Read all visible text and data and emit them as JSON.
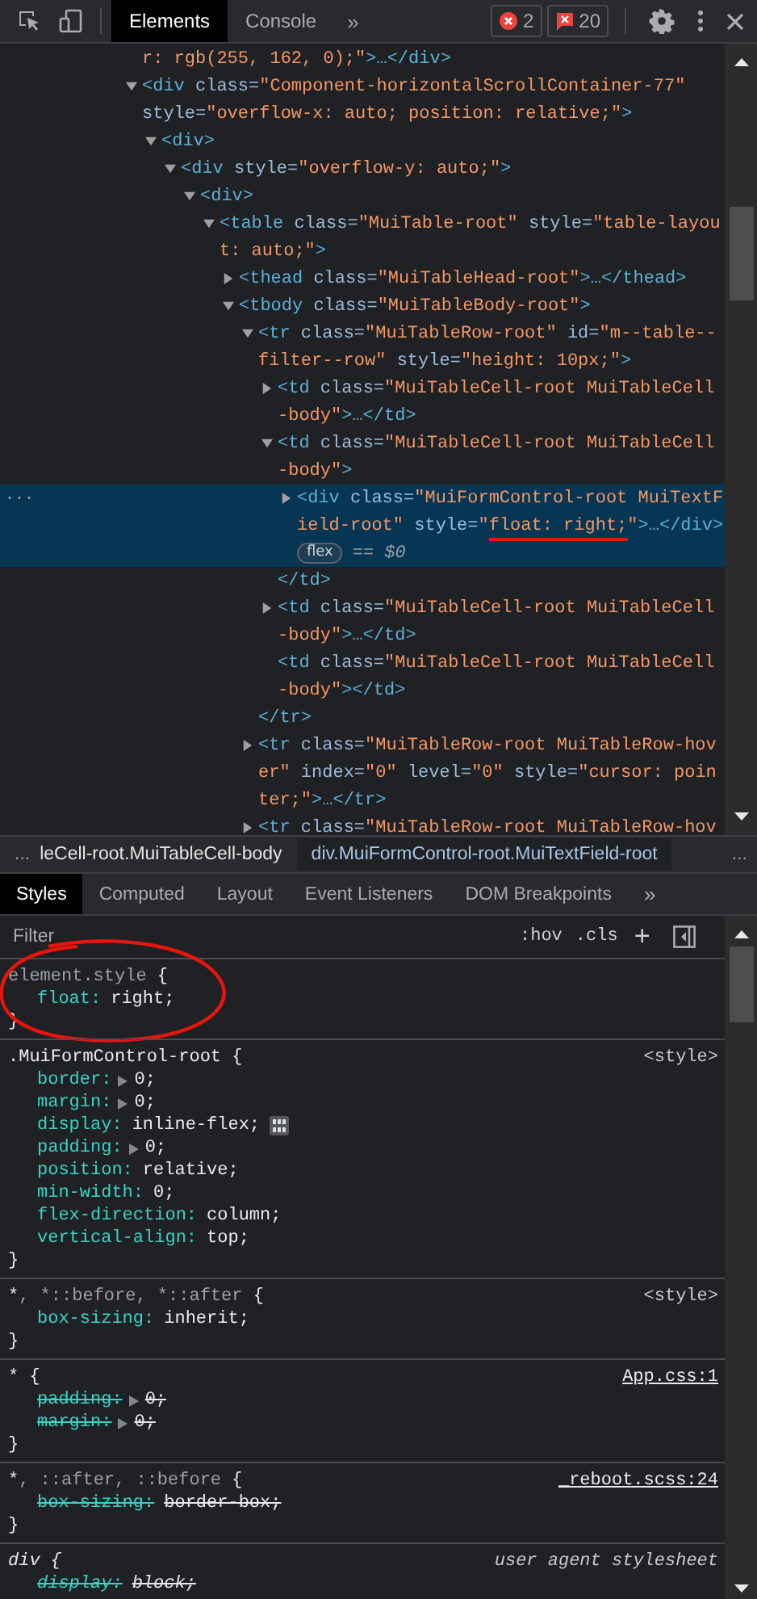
{
  "toolbar": {
    "tabs": [
      {
        "label": "Elements",
        "selected": true
      },
      {
        "label": "Console",
        "selected": false
      }
    ],
    "more": "»",
    "errors": "2",
    "warnings": "20"
  },
  "dom": [
    {
      "selected": false,
      "lines": [
        [
          {
            "kind": "val",
            "text": "r: rgb(255, 162, 0);\""
          },
          {
            "kind": "tag",
            "text": ">…</div>"
          }
        ]
      ]
    },
    {
      "selected": false,
      "expanded": true,
      "lines": [
        [
          {
            "kind": "tag",
            "text": "<div"
          },
          {
            "kind": "attr",
            "text": " class="
          },
          {
            "kind": "val",
            "text": "\"Component-horizontalScrollContainer-77\""
          }
        ],
        [
          {
            "kind": "attr",
            "text": "style="
          },
          {
            "kind": "val",
            "text": "\"overflow-x: auto; position: relative;\""
          },
          {
            "kind": "tag",
            "text": ">"
          }
        ]
      ],
      "children": [
        {
          "selected": false,
          "expanded": true,
          "lines": [
            [
              {
                "kind": "tag",
                "text": "<div>"
              }
            ]
          ],
          "children": [
            {
              "selected": false,
              "expanded": true,
              "lines": [
                [
                  {
                    "kind": "tag",
                    "text": "<div"
                  },
                  {
                    "kind": "attr",
                    "text": " style="
                  },
                  {
                    "kind": "val",
                    "text": "\"overflow-y: auto;\""
                  },
                  {
                    "kind": "tag",
                    "text": ">"
                  }
                ]
              ],
              "children": [
                {
                  "selected": false,
                  "expanded": true,
                  "lines": [
                    [
                      {
                        "kind": "tag",
                        "text": "<div>"
                      }
                    ]
                  ],
                  "children": [
                    {
                      "selected": false,
                      "expanded": true,
                      "lines": [
                        [
                          {
                            "kind": "tag",
                            "text": "<table"
                          },
                          {
                            "kind": "attr",
                            "text": " class="
                          },
                          {
                            "kind": "val",
                            "text": "\"MuiTable-root\""
                          },
                          {
                            "kind": "attr",
                            "text": " style="
                          },
                          {
                            "kind": "val",
                            "text": "\"table-layou"
                          }
                        ],
                        [
                          {
                            "kind": "val",
                            "text": "t: auto;\""
                          },
                          {
                            "kind": "tag",
                            "text": ">"
                          }
                        ]
                      ],
                      "children": [
                        {
                          "selected": false,
                          "expanded": false,
                          "lines": [
                            [
                              {
                                "kind": "tag",
                                "text": "<thead"
                              },
                              {
                                "kind": "attr",
                                "text": " class="
                              },
                              {
                                "kind": "val",
                                "text": "\"MuiTableHead-root\""
                              },
                              {
                                "kind": "tag",
                                "text": ">…</thead>"
                              }
                            ]
                          ]
                        },
                        {
                          "selected": false,
                          "expanded": true,
                          "lines": [
                            [
                              {
                                "kind": "tag",
                                "text": "<tbody"
                              },
                              {
                                "kind": "attr",
                                "text": " class="
                              },
                              {
                                "kind": "val",
                                "text": "\"MuiTableBody-root\""
                              },
                              {
                                "kind": "tag",
                                "text": ">"
                              }
                            ]
                          ],
                          "children": [
                            {
                              "selected": false,
                              "expanded": true,
                              "lines": [
                                [
                                  {
                                    "kind": "tag",
                                    "text": "<tr"
                                  },
                                  {
                                    "kind": "attr",
                                    "text": " class="
                                  },
                                  {
                                    "kind": "val",
                                    "text": "\"MuiTableRow-root\""
                                  },
                                  {
                                    "kind": "attr",
                                    "text": " id="
                                  },
                                  {
                                    "kind": "val",
                                    "text": "\"m--table--"
                                  }
                                ],
                                [
                                  {
                                    "kind": "val",
                                    "text": "filter--row\""
                                  },
                                  {
                                    "kind": "attr",
                                    "text": " style="
                                  },
                                  {
                                    "kind": "val",
                                    "text": "\"height: 10px;\""
                                  },
                                  {
                                    "kind": "tag",
                                    "text": ">"
                                  }
                                ]
                              ],
                              "close": [
                                [
                                  {
                                    "kind": "tag",
                                    "text": "</tr>"
                                  }
                                ]
                              ],
                              "children": [
                                {
                                  "selected": false,
                                  "expanded": false,
                                  "lines": [
                                    [
                                      {
                                        "kind": "tag",
                                        "text": "<td"
                                      },
                                      {
                                        "kind": "attr",
                                        "text": " class="
                                      },
                                      {
                                        "kind": "val",
                                        "text": "\"MuiTableCell-root MuiTableCell"
                                      }
                                    ],
                                    [
                                      {
                                        "kind": "val",
                                        "text": "-body\""
                                      },
                                      {
                                        "kind": "tag",
                                        "text": ">…</td>"
                                      }
                                    ]
                                  ]
                                },
                                {
                                  "selected": false,
                                  "expanded": true,
                                  "lines": [
                                    [
                                      {
                                        "kind": "tag",
                                        "text": "<td"
                                      },
                                      {
                                        "kind": "attr",
                                        "text": " class="
                                      },
                                      {
                                        "kind": "val",
                                        "text": "\"MuiTableCell-root MuiTableCell"
                                      }
                                    ],
                                    [
                                      {
                                        "kind": "val",
                                        "text": "-body\""
                                      },
                                      {
                                        "kind": "tag",
                                        "text": ">"
                                      }
                                    ]
                                  ],
                                  "close": [
                                    [
                                      {
                                        "kind": "tag",
                                        "text": "</td>"
                                      }
                                    ]
                                  ],
                                  "children": [
                                    {
                                      "selected": true,
                                      "expanded": false,
                                      "gutter": "...",
                                      "lines": [
                                        [
                                          {
                                            "kind": "tag",
                                            "text": "<div"
                                          },
                                          {
                                            "kind": "attr",
                                            "text": " class="
                                          },
                                          {
                                            "kind": "val",
                                            "text": "\"MuiFormControl-root MuiTextF"
                                          }
                                        ],
                                        [
                                          {
                                            "kind": "val",
                                            "text": "ield-root\""
                                          },
                                          {
                                            "kind": "attr",
                                            "text": " style="
                                          },
                                          {
                                            "kind": "val",
                                            "text": "\""
                                          },
                                          {
                                            "kind": "val",
                                            "text": "float: right;",
                                            "marked": true
                                          },
                                          {
                                            "kind": "val",
                                            "text": "\""
                                          },
                                          {
                                            "kind": "tag",
                                            "text": ">…</div>"
                                          }
                                        ],
                                        [
                                          {
                                            "kind": "badge",
                                            "text": "flex"
                                          },
                                          {
                                            "kind": "dim",
                                            "text": "== $0"
                                          }
                                        ]
                                      ]
                                    }
                                  ]
                                },
                                {
                                  "selected": false,
                                  "expanded": false,
                                  "lines": [
                                    [
                                      {
                                        "kind": "tag",
                                        "text": "<td"
                                      },
                                      {
                                        "kind": "attr",
                                        "text": " class="
                                      },
                                      {
                                        "kind": "val",
                                        "text": "\"MuiTableCell-root MuiTableCell"
                                      }
                                    ],
                                    [
                                      {
                                        "kind": "val",
                                        "text": "-body\""
                                      },
                                      {
                                        "kind": "tag",
                                        "text": ">…</td>"
                                      }
                                    ]
                                  ]
                                },
                                {
                                  "selected": false,
                                  "lines": [
                                    [
                                      {
                                        "kind": "tag",
                                        "text": "<td"
                                      },
                                      {
                                        "kind": "attr",
                                        "text": " class="
                                      },
                                      {
                                        "kind": "val",
                                        "text": "\"MuiTableCell-root MuiTableCell"
                                      }
                                    ],
                                    [
                                      {
                                        "kind": "val",
                                        "text": "-body\""
                                      },
                                      {
                                        "kind": "tag",
                                        "text": "></td>"
                                      }
                                    ]
                                  ]
                                }
                              ]
                            },
                            {
                              "selected": false,
                              "expanded": false,
                              "lines": [
                                [
                                  {
                                    "kind": "tag",
                                    "text": "<tr"
                                  },
                                  {
                                    "kind": "attr",
                                    "text": " class="
                                  },
                                  {
                                    "kind": "val",
                                    "text": "\"MuiTableRow-root MuiTableRow-hov"
                                  }
                                ],
                                [
                                  {
                                    "kind": "val",
                                    "text": "er\""
                                  },
                                  {
                                    "kind": "attr",
                                    "text": " index="
                                  },
                                  {
                                    "kind": "val",
                                    "text": "\"0\""
                                  },
                                  {
                                    "kind": "attr",
                                    "text": " level="
                                  },
                                  {
                                    "kind": "val",
                                    "text": "\"0\""
                                  },
                                  {
                                    "kind": "attr",
                                    "text": " style="
                                  },
                                  {
                                    "kind": "val",
                                    "text": "\"cursor: poin"
                                  }
                                ],
                                [
                                  {
                                    "kind": "val",
                                    "text": "ter;\""
                                  },
                                  {
                                    "kind": "tag",
                                    "text": ">…</tr>"
                                  }
                                ]
                              ]
                            },
                            {
                              "selected": false,
                              "expanded": false,
                              "lines": [
                                [
                                  {
                                    "kind": "tag",
                                    "text": "<tr"
                                  },
                                  {
                                    "kind": "attr",
                                    "text": " class="
                                  },
                                  {
                                    "kind": "val",
                                    "text": "\"MuiTableRow-root MuiTableRow-hov"
                                  }
                                ]
                              ]
                            }
                          ]
                        }
                      ]
                    }
                  ]
                }
              ]
            }
          ]
        }
      ]
    }
  ],
  "breadcrumbs": {
    "leading": "...",
    "items": [
      {
        "label": "leCell-root.MuiTableCell-body",
        "selected": false
      },
      {
        "label": "div.MuiFormControl-root.MuiTextField-root",
        "selected": true
      }
    ],
    "trailing": "..."
  },
  "sidebar_tabs": {
    "tabs": [
      {
        "label": "Styles",
        "selected": true
      },
      {
        "label": "Computed",
        "selected": false
      },
      {
        "label": "Layout",
        "selected": false
      },
      {
        "label": "Event Listeners",
        "selected": false
      },
      {
        "label": "DOM Breakpoints",
        "selected": false
      }
    ],
    "more": "»"
  },
  "filter": {
    "placeholder": "Filter",
    "hov": ":hov",
    "cls": ".cls",
    "add": "+"
  },
  "rules": [
    {
      "circled": true,
      "selector": [
        {
          "kind": "dim",
          "text": "element.style"
        },
        {
          "kind": "brace",
          "text": " {"
        }
      ],
      "props": [
        {
          "name": "float:",
          "value": "right;",
          "overridden": false
        }
      ],
      "close": "}"
    },
    {
      "circled": false,
      "selector": [
        {
          "kind": "match",
          "text": ".MuiFormControl-root"
        },
        {
          "kind": "brace",
          "text": " {"
        }
      ],
      "source": {
        "text": "<style>",
        "link": false
      },
      "props": [
        {
          "name": "border:",
          "value": "0;",
          "overridden": false,
          "expandable": true
        },
        {
          "name": "margin:",
          "value": "0;",
          "overridden": false,
          "expandable": true
        },
        {
          "name": "display:",
          "value": "inline-flex;",
          "overridden": false,
          "flex_editor": true
        },
        {
          "name": "padding:",
          "value": "0;",
          "overridden": false,
          "expandable": true
        },
        {
          "name": "position:",
          "value": "relative;",
          "overridden": false
        },
        {
          "name": "min-width:",
          "value": "0;",
          "overridden": false
        },
        {
          "name": "flex-direction:",
          "value": "column;",
          "overridden": false
        },
        {
          "name": "vertical-align:",
          "value": "top;",
          "overridden": false
        }
      ],
      "close": "}"
    },
    {
      "circled": false,
      "selector": [
        {
          "kind": "match",
          "text": "*"
        },
        {
          "kind": "dim",
          "text": ", *::before, *::after"
        },
        {
          "kind": "brace",
          "text": " {"
        }
      ],
      "source": {
        "text": "<style>",
        "link": false
      },
      "props": [
        {
          "name": "box-sizing:",
          "value": "inherit;",
          "overridden": false
        }
      ],
      "close": "}"
    },
    {
      "circled": false,
      "selector": [
        {
          "kind": "match",
          "text": "*"
        },
        {
          "kind": "brace",
          "text": " {"
        }
      ],
      "source": {
        "text": "App.css:1",
        "link": true
      },
      "props": [
        {
          "name": "padding:",
          "value": "0;",
          "overridden": true,
          "expandable": true
        },
        {
          "name": "margin:",
          "value": "0;",
          "overridden": true,
          "expandable": true
        }
      ],
      "close": "}"
    },
    {
      "circled": false,
      "selector": [
        {
          "kind": "match",
          "text": "*"
        },
        {
          "kind": "dim",
          "text": ", ::after, ::before"
        },
        {
          "kind": "brace",
          "text": " {"
        }
      ],
      "source": {
        "text": "_reboot.scss:24",
        "link": true
      },
      "props": [
        {
          "name": "box-sizing:",
          "value": "border-box;",
          "overridden": true
        }
      ],
      "close": "}"
    },
    {
      "circled": false,
      "user_agent": true,
      "selector": [
        {
          "kind": "match",
          "text": "div"
        },
        {
          "kind": "brace",
          "text": " {"
        }
      ],
      "source": {
        "text": "user agent stylesheet",
        "link": false
      },
      "props": [
        {
          "name": "display:",
          "value": "block;",
          "overridden": true
        }
      ]
    }
  ]
}
